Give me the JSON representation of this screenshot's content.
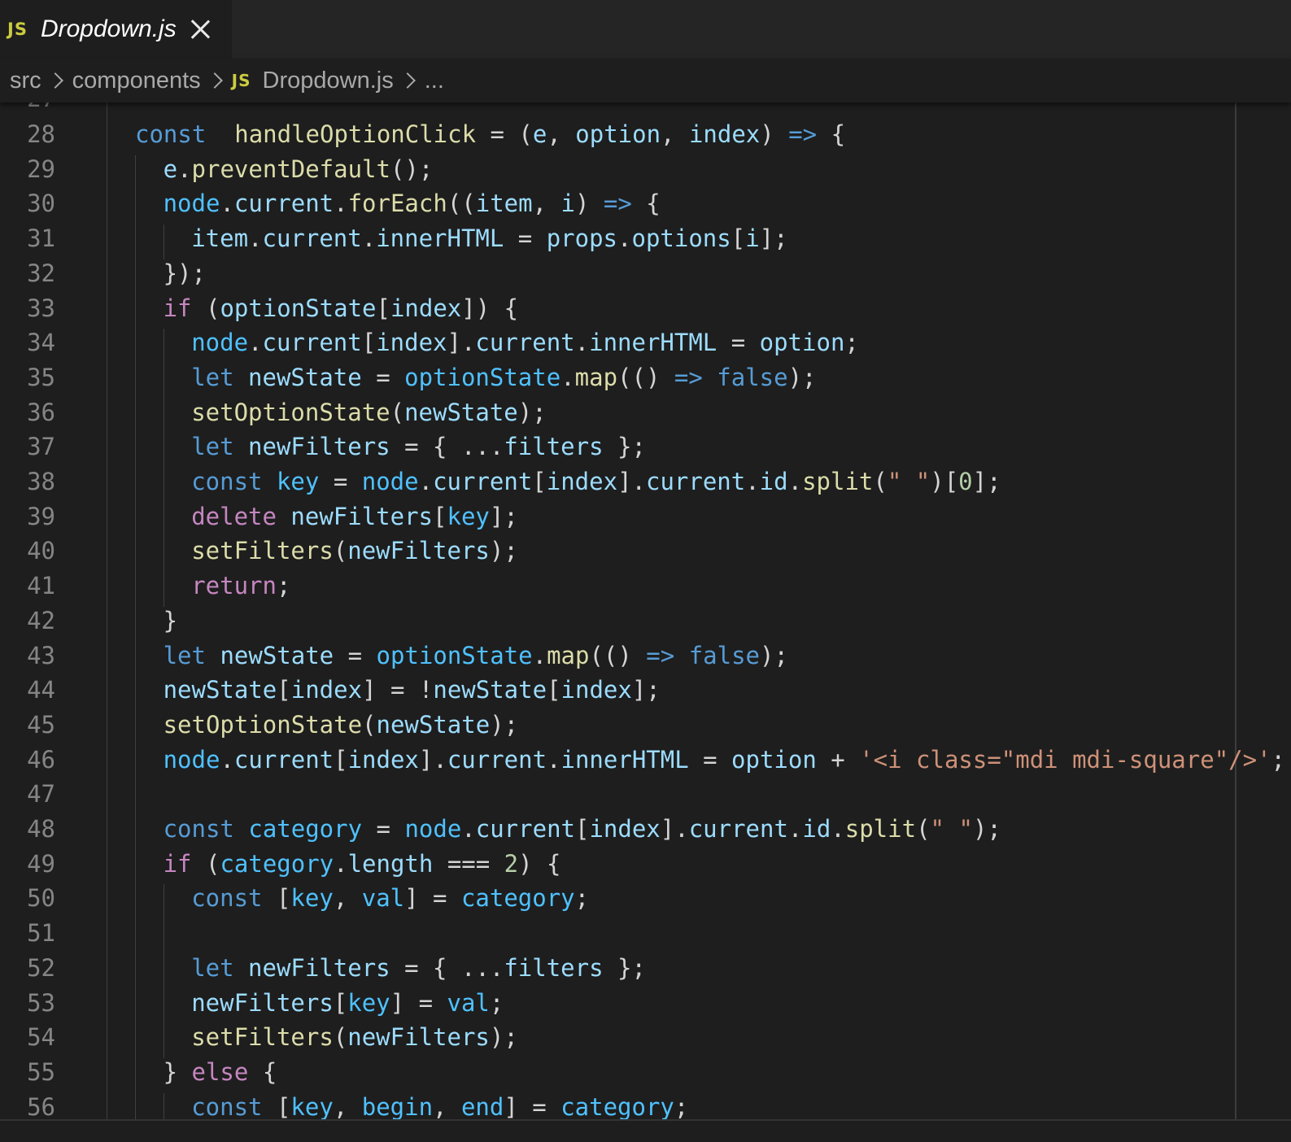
{
  "tab": {
    "badge": "JS",
    "label": "Dropdown.js"
  },
  "breadcrumb": {
    "items": [
      "src",
      "components",
      "Dropdown.js",
      "..."
    ],
    "file_badge": "JS"
  },
  "editor": {
    "partial_top_line_number": "27",
    "lines": [
      {
        "num": "28",
        "indent": 0,
        "tokens": [
          [
            "kw",
            "const"
          ],
          [
            "",
            "  "
          ],
          [
            "fn",
            "handleOptionClick"
          ],
          [
            "",
            " = ("
          ],
          [
            "var",
            "e"
          ],
          [
            "",
            ", "
          ],
          [
            "var",
            "option"
          ],
          [
            "",
            ", "
          ],
          [
            "var",
            "index"
          ],
          [
            "",
            ") "
          ],
          [
            "kw",
            "=>"
          ],
          [
            "",
            " {"
          ]
        ]
      },
      {
        "num": "29",
        "indent": 1,
        "tokens": [
          [
            "var",
            "e"
          ],
          [
            "",
            "."
          ],
          [
            "fn",
            "preventDefault"
          ],
          [
            "",
            "();"
          ]
        ]
      },
      {
        "num": "30",
        "indent": 1,
        "tokens": [
          [
            "cst",
            "node"
          ],
          [
            "",
            "."
          ],
          [
            "var",
            "current"
          ],
          [
            "",
            "."
          ],
          [
            "fn",
            "forEach"
          ],
          [
            "",
            "(("
          ],
          [
            "var",
            "item"
          ],
          [
            "",
            ", "
          ],
          [
            "var",
            "i"
          ],
          [
            "",
            ") "
          ],
          [
            "kw",
            "=>"
          ],
          [
            "",
            " {"
          ]
        ]
      },
      {
        "num": "31",
        "indent": 2,
        "tokens": [
          [
            "var",
            "item"
          ],
          [
            "",
            "."
          ],
          [
            "var",
            "current"
          ],
          [
            "",
            "."
          ],
          [
            "var",
            "innerHTML"
          ],
          [
            "",
            " = "
          ],
          [
            "var",
            "props"
          ],
          [
            "",
            "."
          ],
          [
            "var",
            "options"
          ],
          [
            "",
            "["
          ],
          [
            "var",
            "i"
          ],
          [
            "",
            "];"
          ]
        ]
      },
      {
        "num": "32",
        "indent": 1,
        "tokens": [
          [
            "",
            "});"
          ]
        ]
      },
      {
        "num": "33",
        "indent": 1,
        "tokens": [
          [
            "ctl",
            "if"
          ],
          [
            "",
            " ("
          ],
          [
            "var",
            "optionState"
          ],
          [
            "",
            "["
          ],
          [
            "var",
            "index"
          ],
          [
            "",
            "]) {"
          ]
        ]
      },
      {
        "num": "34",
        "indent": 2,
        "tokens": [
          [
            "cst",
            "node"
          ],
          [
            "",
            "."
          ],
          [
            "var",
            "current"
          ],
          [
            "",
            "["
          ],
          [
            "var",
            "index"
          ],
          [
            "",
            "]."
          ],
          [
            "var",
            "current"
          ],
          [
            "",
            "."
          ],
          [
            "var",
            "innerHTML"
          ],
          [
            "",
            " = "
          ],
          [
            "var",
            "option"
          ],
          [
            "",
            ";"
          ]
        ]
      },
      {
        "num": "35",
        "indent": 2,
        "tokens": [
          [
            "kw",
            "let"
          ],
          [
            "",
            " "
          ],
          [
            "var",
            "newState"
          ],
          [
            "",
            " = "
          ],
          [
            "cst",
            "optionState"
          ],
          [
            "",
            "."
          ],
          [
            "fn",
            "map"
          ],
          [
            "",
            "(() "
          ],
          [
            "kw",
            "=>"
          ],
          [
            "",
            " "
          ],
          [
            "kw",
            "false"
          ],
          [
            "",
            ");"
          ]
        ]
      },
      {
        "num": "36",
        "indent": 2,
        "tokens": [
          [
            "fn",
            "setOptionState"
          ],
          [
            "",
            "("
          ],
          [
            "var",
            "newState"
          ],
          [
            "",
            ");"
          ]
        ]
      },
      {
        "num": "37",
        "indent": 2,
        "tokens": [
          [
            "kw",
            "let"
          ],
          [
            "",
            " "
          ],
          [
            "var",
            "newFilters"
          ],
          [
            "",
            " = { ..."
          ],
          [
            "var",
            "filters"
          ],
          [
            "",
            " };"
          ]
        ]
      },
      {
        "num": "38",
        "indent": 2,
        "tokens": [
          [
            "kw",
            "const"
          ],
          [
            "",
            " "
          ],
          [
            "cst",
            "key"
          ],
          [
            "",
            " = "
          ],
          [
            "cst",
            "node"
          ],
          [
            "",
            "."
          ],
          [
            "var",
            "current"
          ],
          [
            "",
            "["
          ],
          [
            "var",
            "index"
          ],
          [
            "",
            "]."
          ],
          [
            "var",
            "current"
          ],
          [
            "",
            "."
          ],
          [
            "var",
            "id"
          ],
          [
            "",
            "."
          ],
          [
            "fn",
            "split"
          ],
          [
            "",
            "("
          ],
          [
            "str",
            "\" \""
          ],
          [
            "",
            ")["
          ],
          [
            "num",
            "0"
          ],
          [
            "",
            "];"
          ]
        ]
      },
      {
        "num": "39",
        "indent": 2,
        "tokens": [
          [
            "ctl",
            "delete"
          ],
          [
            "",
            " "
          ],
          [
            "var",
            "newFilters"
          ],
          [
            "",
            "["
          ],
          [
            "cst",
            "key"
          ],
          [
            "",
            "];"
          ]
        ]
      },
      {
        "num": "40",
        "indent": 2,
        "tokens": [
          [
            "fn",
            "setFilters"
          ],
          [
            "",
            "("
          ],
          [
            "var",
            "newFilters"
          ],
          [
            "",
            ");"
          ]
        ]
      },
      {
        "num": "41",
        "indent": 2,
        "tokens": [
          [
            "ctl",
            "return"
          ],
          [
            "",
            ";"
          ]
        ]
      },
      {
        "num": "42",
        "indent": 1,
        "tokens": [
          [
            "",
            "}"
          ]
        ]
      },
      {
        "num": "43",
        "indent": 1,
        "tokens": [
          [
            "kw",
            "let"
          ],
          [
            "",
            " "
          ],
          [
            "var",
            "newState"
          ],
          [
            "",
            " = "
          ],
          [
            "cst",
            "optionState"
          ],
          [
            "",
            "."
          ],
          [
            "fn",
            "map"
          ],
          [
            "",
            "(() "
          ],
          [
            "kw",
            "=>"
          ],
          [
            "",
            " "
          ],
          [
            "kw",
            "false"
          ],
          [
            "",
            ");"
          ]
        ]
      },
      {
        "num": "44",
        "indent": 1,
        "tokens": [
          [
            "var",
            "newState"
          ],
          [
            "",
            "["
          ],
          [
            "var",
            "index"
          ],
          [
            "",
            "] = !"
          ],
          [
            "var",
            "newState"
          ],
          [
            "",
            "["
          ],
          [
            "var",
            "index"
          ],
          [
            "",
            "];"
          ]
        ]
      },
      {
        "num": "45",
        "indent": 1,
        "tokens": [
          [
            "fn",
            "setOptionState"
          ],
          [
            "",
            "("
          ],
          [
            "var",
            "newState"
          ],
          [
            "",
            ");"
          ]
        ]
      },
      {
        "num": "46",
        "indent": 1,
        "tokens": [
          [
            "cst",
            "node"
          ],
          [
            "",
            "."
          ],
          [
            "var",
            "current"
          ],
          [
            "",
            "["
          ],
          [
            "var",
            "index"
          ],
          [
            "",
            "]."
          ],
          [
            "var",
            "current"
          ],
          [
            "",
            "."
          ],
          [
            "var",
            "innerHTML"
          ],
          [
            "",
            " = "
          ],
          [
            "var",
            "option"
          ],
          [
            "",
            " + "
          ],
          [
            "str",
            "'<i class=\"mdi mdi-square\"/>'"
          ],
          [
            "",
            ";"
          ]
        ]
      },
      {
        "num": "47",
        "indent": 1,
        "tokens": []
      },
      {
        "num": "48",
        "indent": 1,
        "tokens": [
          [
            "kw",
            "const"
          ],
          [
            "",
            " "
          ],
          [
            "cst",
            "category"
          ],
          [
            "",
            " = "
          ],
          [
            "cst",
            "node"
          ],
          [
            "",
            "."
          ],
          [
            "var",
            "current"
          ],
          [
            "",
            "["
          ],
          [
            "var",
            "index"
          ],
          [
            "",
            "]."
          ],
          [
            "var",
            "current"
          ],
          [
            "",
            "."
          ],
          [
            "var",
            "id"
          ],
          [
            "",
            "."
          ],
          [
            "fn",
            "split"
          ],
          [
            "",
            "("
          ],
          [
            "str",
            "\" \""
          ],
          [
            "",
            ");"
          ]
        ]
      },
      {
        "num": "49",
        "indent": 1,
        "tokens": [
          [
            "ctl",
            "if"
          ],
          [
            "",
            " ("
          ],
          [
            "cst",
            "category"
          ],
          [
            "",
            "."
          ],
          [
            "var",
            "length"
          ],
          [
            "",
            " === "
          ],
          [
            "num",
            "2"
          ],
          [
            "",
            ") {"
          ]
        ]
      },
      {
        "num": "50",
        "indent": 2,
        "tokens": [
          [
            "kw",
            "const"
          ],
          [
            "",
            " ["
          ],
          [
            "cst",
            "key"
          ],
          [
            "",
            ", "
          ],
          [
            "cst",
            "val"
          ],
          [
            "",
            "] = "
          ],
          [
            "cst",
            "category"
          ],
          [
            "",
            ";"
          ]
        ]
      },
      {
        "num": "51",
        "indent": 2,
        "tokens": []
      },
      {
        "num": "52",
        "indent": 2,
        "tokens": [
          [
            "kw",
            "let"
          ],
          [
            "",
            " "
          ],
          [
            "var",
            "newFilters"
          ],
          [
            "",
            " = { ..."
          ],
          [
            "var",
            "filters"
          ],
          [
            "",
            " };"
          ]
        ]
      },
      {
        "num": "53",
        "indent": 2,
        "tokens": [
          [
            "var",
            "newFilters"
          ],
          [
            "",
            "["
          ],
          [
            "cst",
            "key"
          ],
          [
            "",
            "] = "
          ],
          [
            "cst",
            "val"
          ],
          [
            "",
            ";"
          ]
        ]
      },
      {
        "num": "54",
        "indent": 2,
        "tokens": [
          [
            "fn",
            "setFilters"
          ],
          [
            "",
            "("
          ],
          [
            "var",
            "newFilters"
          ],
          [
            "",
            ");"
          ]
        ]
      },
      {
        "num": "55",
        "indent": 1,
        "tokens": [
          [
            "",
            "} "
          ],
          [
            "ctl",
            "else"
          ],
          [
            "",
            " {"
          ]
        ]
      },
      {
        "num": "56",
        "indent": 2,
        "tokens": [
          [
            "kw",
            "const"
          ],
          [
            "",
            " ["
          ],
          [
            "cst",
            "key"
          ],
          [
            "",
            ", "
          ],
          [
            "cst",
            "begin"
          ],
          [
            "",
            ", "
          ],
          [
            "cst",
            "end"
          ],
          [
            "",
            "] = "
          ],
          [
            "cst",
            "category"
          ],
          [
            "",
            ";"
          ]
        ]
      }
    ]
  }
}
